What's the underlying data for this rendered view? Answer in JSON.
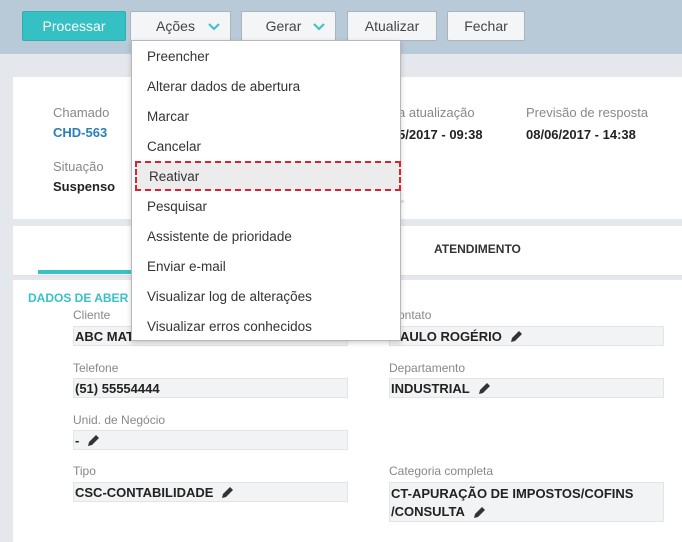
{
  "toolbar": {
    "processar": "Processar",
    "acoes": "Ações",
    "gerar": "Gerar",
    "atualizar": "Atualizar",
    "fechar": "Fechar"
  },
  "header": {
    "chamado_label": "Chamado",
    "chamado_value": "CHD-563",
    "situacao_label": "Situação",
    "situacao_value": "Suspenso",
    "atualizacao_label": "a atualização",
    "atualizacao_value": "5/2017 - 09:38",
    "previsao_label": "Previsão de resposta",
    "previsao_value": "08/06/2017 - 14:38"
  },
  "tabs": {
    "atendimento": "ATENDIMENTO"
  },
  "section": {
    "title": "DADOS DE ABER"
  },
  "fields": {
    "cliente_label": "Cliente",
    "cliente_value": "ABC MAT",
    "contato_label": "ontato",
    "contato_value": "AULO ROGÉRIO",
    "telefone_label": "Telefone",
    "telefone_value": "(51) 55554444",
    "departamento_label": "Departamento",
    "departamento_value": "INDUSTRIAL",
    "unid_label": "Unid. de Negócio",
    "unid_value": "-",
    "tipo_label": "Tipo",
    "tipo_value": "CSC-CONTABILIDADE",
    "categoria_label": "Categoria completa",
    "categoria_value_1": "CT-APURAÇÃO DE IMPOSTOS/COFINS",
    "categoria_value_2": "/CONSULTA"
  },
  "menu": {
    "items": [
      "Preencher",
      "Alterar dados de abertura",
      "Marcar",
      "Cancelar",
      "Reativar",
      "Pesquisar",
      "Assistente de prioridade",
      "Enviar e-mail",
      "Visualizar log de alterações",
      "Visualizar erros conhecidos"
    ],
    "active_index": 4
  },
  "colors": {
    "accent": "#35c0c4",
    "link": "#2a7fb8",
    "highlight_border": "#d9232e"
  }
}
